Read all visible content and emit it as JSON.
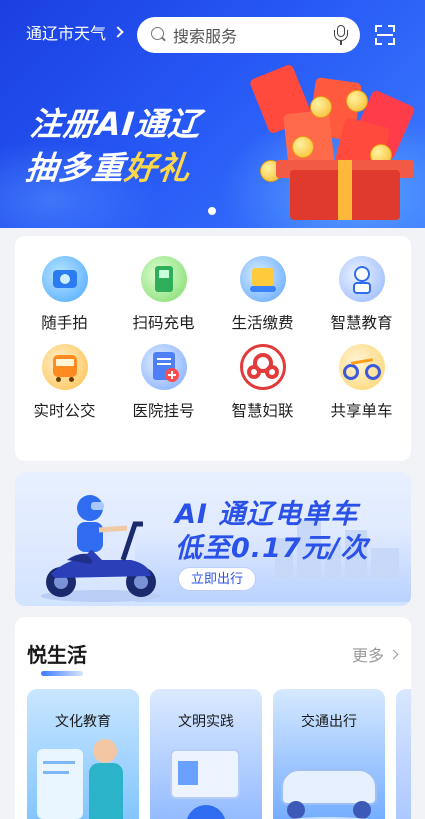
{
  "header": {
    "city_weather": "通辽市天气",
    "search_placeholder": "搜索服务"
  },
  "banner": {
    "line1": "注册AI通辽",
    "line2_a": "抽多重",
    "line2_b": "好礼",
    "page_indicator_count": 1
  },
  "services": [
    {
      "label": "随手拍",
      "icon": "camera-icon"
    },
    {
      "label": "扫码充电",
      "icon": "charging-station-icon"
    },
    {
      "label": "生活缴费",
      "icon": "bill-payment-icon"
    },
    {
      "label": "智慧教育",
      "icon": "robot-astronaut-icon"
    },
    {
      "label": "实时公交",
      "icon": "bus-icon"
    },
    {
      "label": "医院挂号",
      "icon": "hospital-clipboard-icon"
    },
    {
      "label": "智慧妇联",
      "icon": "womens-federation-icon"
    },
    {
      "label": "共享单车",
      "icon": "bicycle-icon"
    }
  ],
  "ride_banner": {
    "title": "AI 通辽电单车",
    "subtitle": "低至0.17元/次",
    "button": "立即出行"
  },
  "life": {
    "title": "悦生活",
    "more": "更多",
    "tiles": [
      "文化教育",
      "文明实践",
      "交通出行"
    ]
  },
  "colors": {
    "primary": "#2657f5",
    "accent_yellow": "#ffd84a",
    "ride_text": "#2a52e8"
  }
}
